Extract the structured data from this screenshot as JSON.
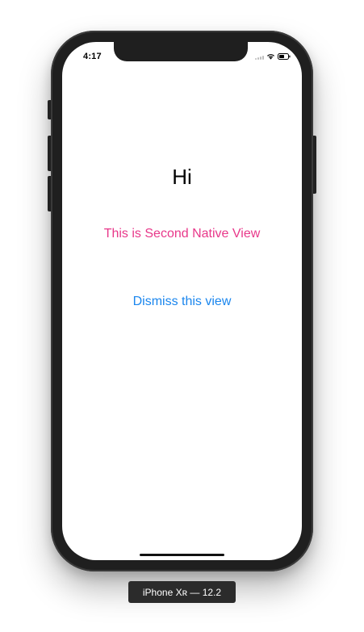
{
  "status_bar": {
    "time": "4:17"
  },
  "content": {
    "greeting": "Hi",
    "subtitle": "This is Second Native View",
    "dismiss_label": "Dismiss this view"
  },
  "simulator": {
    "device_label": "iPhone Xʀ — 12.2"
  },
  "icons": [
    "signal-icon",
    "wifi-icon",
    "battery-icon"
  ],
  "colors": {
    "subtitle": "#e8388a",
    "link": "#1a86ee",
    "frame": "#1f1f1f"
  }
}
